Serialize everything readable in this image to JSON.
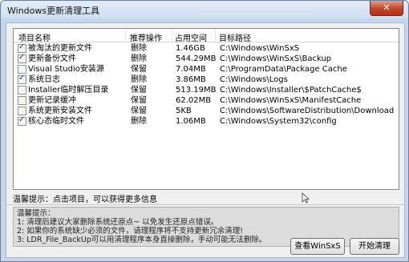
{
  "window": {
    "title": "Windows更新清理工具",
    "close_label": "✕"
  },
  "table": {
    "columns": [
      "项目名称",
      "推荐操作",
      "占用空间",
      "目标路径"
    ],
    "rows": [
      {
        "checked": true,
        "name": "被淘汰的更新文件",
        "action": "删除",
        "size": "1.46GB",
        "path": "C:\\Windows\\WinSxS"
      },
      {
        "checked": true,
        "name": "更新备份文件",
        "action": "删除",
        "size": "544.29MB",
        "path": "C:\\Windows\\WinSxS\\Backup"
      },
      {
        "checked": false,
        "name": "Visual Studio安装源",
        "action": "保留",
        "size": "7.04MB",
        "path": "C:\\ProgramData\\Package Cache"
      },
      {
        "checked": true,
        "name": "系统日志",
        "action": "删除",
        "size": "3.86MB",
        "path": "C:\\Windows\\Logs"
      },
      {
        "checked": false,
        "name": "Installer临时解压目录",
        "action": "保留",
        "size": "513.19MB",
        "path": "C:\\Windows\\Installer\\$PatchCache$"
      },
      {
        "checked": false,
        "name": "更新记录缓冲",
        "action": "保留",
        "size": "62.02MB",
        "path": "C:\\Windows\\WinSxS\\ManifestCache"
      },
      {
        "checked": false,
        "name": "系统更新安装文件",
        "action": "保留",
        "size": "5KB",
        "path": "C:\\Windows\\SoftwareDistribution\\Download"
      },
      {
        "checked": true,
        "name": "核心态临时文件",
        "action": "删除",
        "size": "1.06MB",
        "path": "C:\\Windows\\System32\\config"
      }
    ]
  },
  "tip": "温馨提示：点击项目，可以获得更多信息",
  "notes": {
    "heading": "温馨提示：",
    "lines": [
      "1: 清理后建议大家删除系统还原点~ 以免发生还原点错误。",
      "2: 如果你的系统缺少必须的文件，请理程序将不支持更新冗余清理!",
      "3: LDR_File_BackUp可以用清理程序本身直接删除，手动可能无法删除。"
    ]
  },
  "buttons": {
    "view_winsxs": "查看WinSxS",
    "start_clean": "开始清理"
  }
}
